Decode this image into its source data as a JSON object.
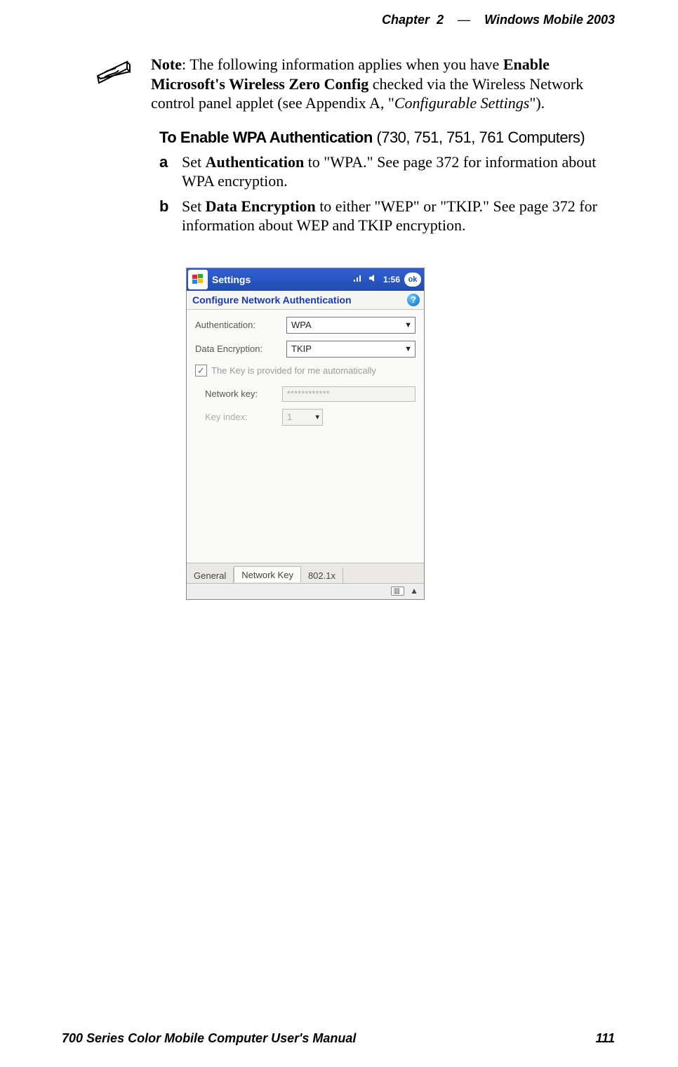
{
  "header": {
    "chapter_label": "Chapter",
    "chapter_number": "2",
    "dash": "—",
    "title": "Windows Mobile 2003"
  },
  "footer": {
    "manual": "700 Series Color Mobile Computer User's Manual",
    "page_number": "111"
  },
  "note": {
    "label": "Note",
    "text_1": ": The following information applies when you have ",
    "bold_1": "Enable Microsoft's Wireless Zero Config",
    "text_2": " checked via the Wireless Network control panel applet (see Appendix A, \"",
    "italic_1": "Configurable Settings",
    "text_3": "\")."
  },
  "subhead": {
    "bold": "To Enable WPA Authentication",
    "rest": " (730, 751, 751, 761 Computers)"
  },
  "steps": {
    "a": {
      "letter": "a",
      "t1": "Set ",
      "b1": "Authentication",
      "t2": " to \"WPA.\" See page 372 for information about WPA encryption."
    },
    "b": {
      "letter": "b",
      "t1": "Set ",
      "b1": "Data Encryption",
      "t2": " to either \"WEP\" or \"TKIP.\" See page 372 for information about WEP and TKIP encryption."
    }
  },
  "mock": {
    "titlebar": {
      "title": "Settings",
      "signal_icon": "📶",
      "speaker_icon": "🔊",
      "time": "1:56",
      "ok": "ok"
    },
    "subhead": "Configure Network Authentication",
    "help_icon_label": "?",
    "fields": {
      "auth_label": "Authentication:",
      "auth_value": "WPA",
      "enc_label": "Data Encryption:",
      "enc_value": "TKIP",
      "auto_key_label": "The Key is provided for me automatically",
      "auto_key_checked": true,
      "network_key_label": "Network key:",
      "network_key_value": "************",
      "key_index_label": "Key index:",
      "key_index_value": "1"
    },
    "tabs": {
      "general": "General",
      "network_key": "Network Key",
      "x8021": "802.1x"
    },
    "statusbar": {
      "kbd_icon": "⌨",
      "up_arrow": "▲"
    }
  }
}
